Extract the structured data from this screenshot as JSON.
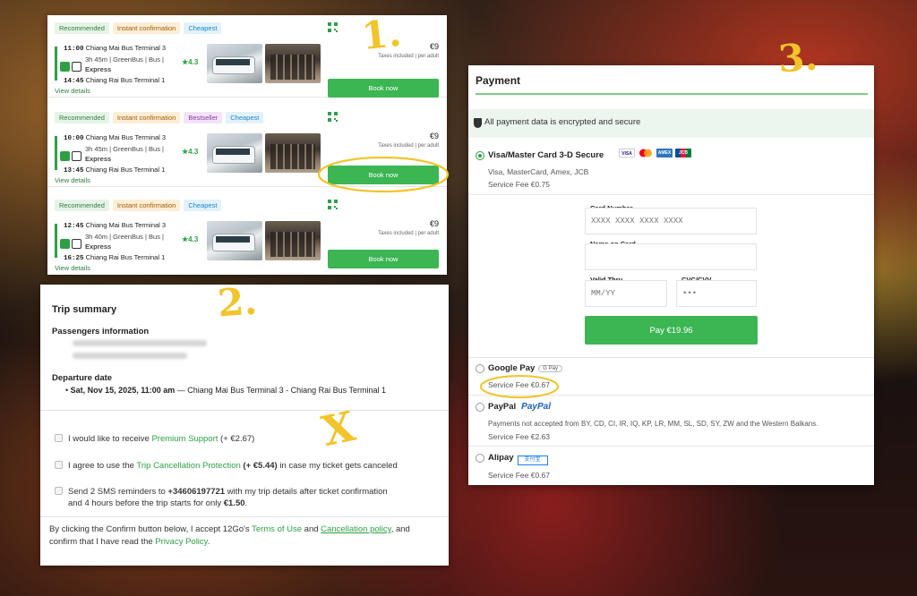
{
  "results": {
    "badge_recommended": "Recommended",
    "badge_instant": "Instant confirmation",
    "badge_cheapest": "Cheapest",
    "badge_bestseller": "Bestseller",
    "trips": [
      {
        "dep_time": "11:00",
        "dep_station": "Chiang Mai Bus Terminal 3",
        "details": "3h 45m | GreenBus | Bus |",
        "class": "Express",
        "arr_time": "14:45",
        "arr_station": "Chiang Rai Bus Terminal 1",
        "rating": "4.3",
        "price": "€9",
        "taxes": "Taxes included | per adult",
        "book": "Book now",
        "view": "View details"
      },
      {
        "dep_time": "10:00",
        "dep_station": "Chiang Mai Bus Terminal 3",
        "details": "3h 45m | GreenBus | Bus |",
        "class": "Express",
        "arr_time": "13:45",
        "arr_station": "Chiang Rai Bus Terminal 1",
        "rating": "4.3",
        "price": "€9",
        "taxes": "Taxes included | per adult",
        "book": "Book now",
        "view": "View details"
      },
      {
        "dep_time": "12:45",
        "dep_station": "Chiang Mai Bus Terminal 3",
        "details": "3h 40m | GreenBus | Bus |",
        "class": "Express",
        "arr_time": "16:25",
        "arr_station": "Chiang Rai Bus Terminal 1",
        "rating": "4.3",
        "price": "€9",
        "taxes": "Taxes included | per adult",
        "book": "Book now",
        "view": "View details"
      }
    ]
  },
  "summary": {
    "title": "Trip summary",
    "passengers_heading": "Passengers information",
    "departure_heading": "Departure date",
    "departure_date": "Sat, Nov 15, 2025, 11:00 am",
    "departure_route": " — Chiang Mai Bus Terminal 3 - Chiang Rai Bus Terminal 1",
    "opt1_pre": "I would like to receive ",
    "opt1_link": "Premium Support",
    "opt1_price": " (+ €2.67)",
    "opt2_pre": "I agree to use the ",
    "opt2_link": "Trip Cancellation Protection",
    "opt2_price": " (+ €5.44)",
    "opt2_post": " in case my ticket gets canceled",
    "opt3_pre": "Send 2 SMS reminders to ",
    "opt3_phone": "+34606197721",
    "opt3_mid": " with my trip details after ticket confirmation",
    "opt3_line2": "and 4 hours before the trip starts for only ",
    "opt3_price": "€1.50",
    "opt3_end": ".",
    "legal_pre": "By clicking the Confirm button below, I accept 12Go's ",
    "legal_terms": "Terms of Use",
    "legal_and": " and ",
    "legal_cancel": "Cancellation policy",
    "legal_mid": ", and",
    "legal_line2": "confirm that I have read the ",
    "legal_privacy": "Privacy Policy",
    "legal_end": "."
  },
  "payment": {
    "title": "Payment",
    "secure": "All payment data is encrypted and secure",
    "card_method": "Visa/Master Card 3-D Secure",
    "card_types": "Visa, MasterCard, Amex, JCB",
    "card_fee": "Service Fee €0.75",
    "card_logos": [
      "VISA",
      "",
      "AMEX",
      "JCB"
    ],
    "card_number_label": "Card Number",
    "card_number_placeholder": "XXXX XXXX XXXX XXXX",
    "name_label": "Name on Card",
    "valid_label": "Valid Thru",
    "valid_placeholder": "MM/YY",
    "cvc_label": "CVC/CVV",
    "cvc_placeholder": "•••",
    "pay_button": "Pay  €19.96",
    "gpay_method": "Google Pay",
    "gpay_tag": "G Pay",
    "gpay_fee": "Service Fee €0.67",
    "paypal_method": "PayPal",
    "paypal_logo": "PayPal",
    "paypal_note": "Payments not accepted from BY, CD, CI, IR, IQ, KP, LR, MM, SL, SD, SY, ZW and the Western Balkans.",
    "paypal_fee": "Service Fee €2.63",
    "alipay_method": "Alipay",
    "alipay_logo": "支付宝",
    "alipay_fee": "Service Fee €0.67"
  },
  "annotations": {
    "step1": "1.",
    "step2": "2.",
    "step3": "3.",
    "cross": "X"
  },
  "colors": {
    "accent": "#3cb553",
    "annotation": "#f2c42b"
  }
}
